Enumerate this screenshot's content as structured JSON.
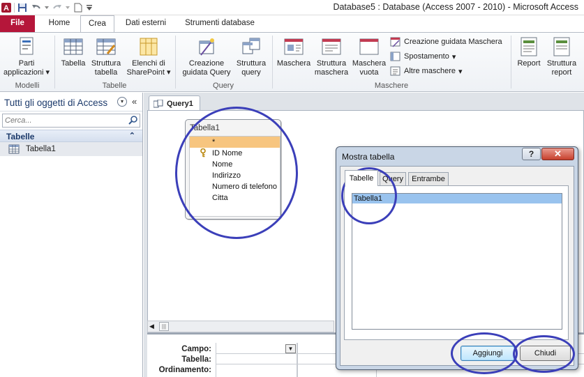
{
  "window": {
    "title": "Database5 : Database (Access 2007 - 2010)  -  Microsoft Access",
    "app_icon": "access-app-icon",
    "quick_access": [
      "save-icon",
      "undo-icon",
      "redo-icon",
      "new-document-icon",
      "customize-qat-icon"
    ]
  },
  "ribbon_tabs": [
    {
      "label": "File"
    },
    {
      "label": "Home"
    },
    {
      "label": "Crea"
    },
    {
      "label": "Dati esterni"
    },
    {
      "label": "Strumenti database"
    }
  ],
  "active_tab": "Crea",
  "ribbon": {
    "groups": {
      "modelli": "Modelli",
      "tabelle": "Tabelle",
      "query": "Query",
      "maschere": "Maschere"
    },
    "buttons": {
      "parti_1": "Parti",
      "parti_2": "applicazioni",
      "tabella": "Tabella",
      "struttura_tabella_1": "Struttura",
      "struttura_tabella_2": "tabella",
      "elenchi_1": "Elenchi di",
      "elenchi_2": "SharePoint",
      "creazione_query_1": "Creazione",
      "creazione_query_2": "guidata Query",
      "struttura_query_1": "Struttura",
      "struttura_query_2": "query",
      "maschera": "Maschera",
      "struttura_maschera_1": "Struttura",
      "struttura_maschera_2": "maschera",
      "maschera_vuota_1": "Maschera",
      "maschera_vuota_2": "vuota",
      "creazione_maschera": "Creazione guidata Maschera",
      "spostamento": "Spostamento",
      "altre_maschere": "Altre maschere",
      "report": "Report",
      "struttura_report_1": "Struttura",
      "struttura_report_2": "report"
    },
    "colors": {
      "file_tab": "#b5163a"
    }
  },
  "nav": {
    "title": "Tutti gli oggetti di Access",
    "search_placeholder": "Cerca...",
    "group": "Tabelle",
    "items": [
      {
        "label": "Tabella1"
      }
    ]
  },
  "document": {
    "tab_label": "Query1",
    "table": {
      "title": "Tabella1",
      "fields": [
        "*",
        "ID Nome",
        "Nome",
        "Indirizzo",
        "Numero di telefono",
        "Citta"
      ],
      "selected_field": "*",
      "key_field": "ID Nome"
    },
    "grid_labels": [
      "Campo:",
      "Tabella:",
      "Ordinamento:"
    ]
  },
  "dialog": {
    "title": "Mostra tabella",
    "help": "?",
    "close": "✕",
    "tabs": [
      "Tabelle",
      "Query",
      "Entrambe"
    ],
    "active_tab": "Tabelle",
    "list": [
      "Tabella1"
    ],
    "selected": "Tabella1",
    "buttons": {
      "add": "Aggiungi",
      "close": "Chiudi"
    }
  },
  "annotation_color": "#3b3fb9"
}
